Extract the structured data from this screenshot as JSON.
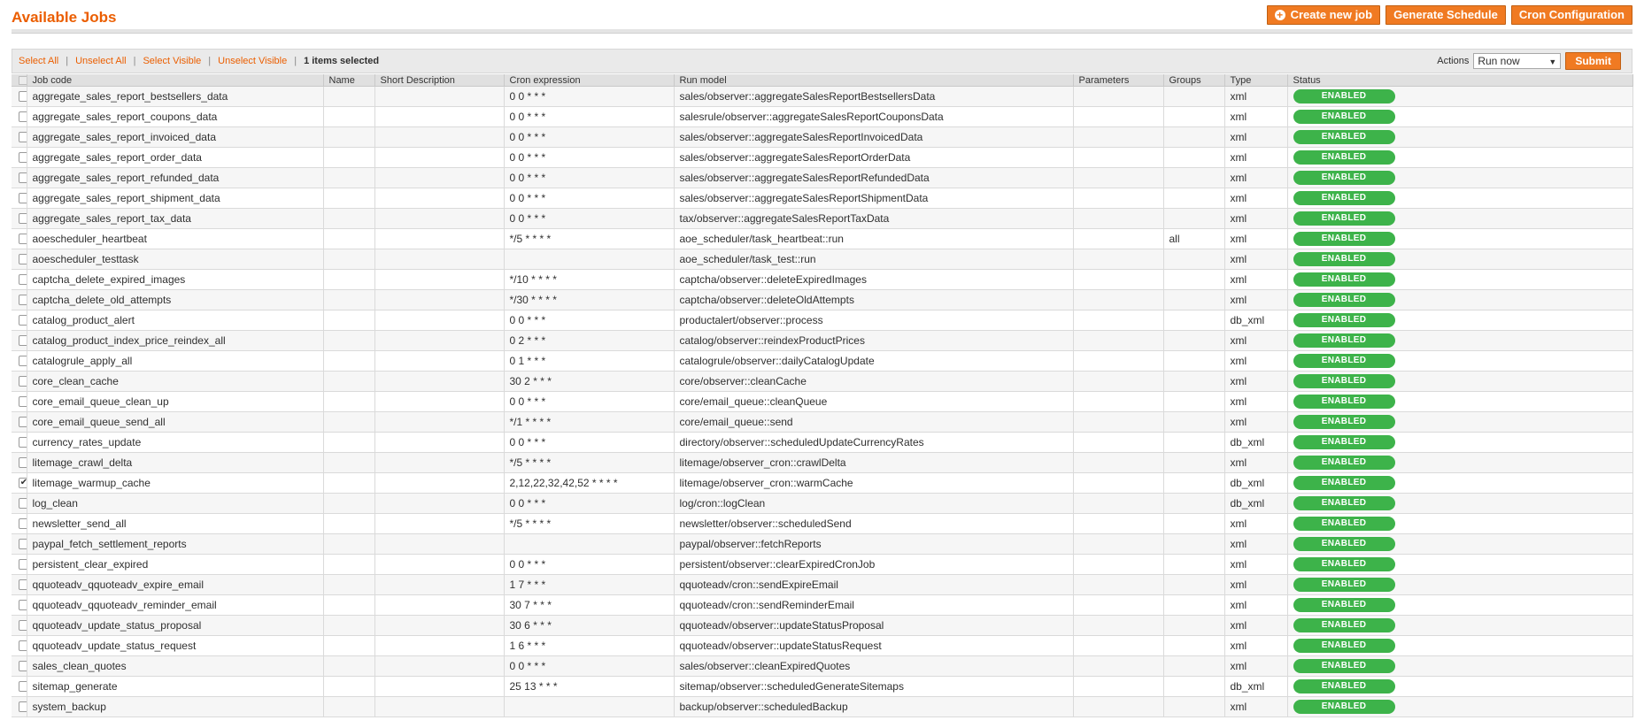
{
  "page": {
    "title": "Available Jobs",
    "buttons": {
      "create": "Create new job",
      "generate": "Generate Schedule",
      "config": "Cron Configuration"
    }
  },
  "massaction": {
    "select_all": "Select All",
    "unselect_all": "Unselect All",
    "select_visible": "Select Visible",
    "unselect_visible": "Unselect Visible",
    "selected_count": "1 items selected",
    "actions_label": "Actions",
    "action_value": "Run now",
    "submit_label": "Submit"
  },
  "grid": {
    "columns": [
      "Job code",
      "Name",
      "Short Description",
      "Cron expression",
      "Run model",
      "Parameters",
      "Groups",
      "Type",
      "Status"
    ],
    "rows": [
      {
        "code": "aggregate_sales_report_bestsellers_data",
        "cron": "0 0 * * *",
        "model": "sales/observer::aggregateSalesReportBestsellersData",
        "groups": "",
        "type": "xml",
        "status": "ENABLED",
        "checked": false
      },
      {
        "code": "aggregate_sales_report_coupons_data",
        "cron": "0 0 * * *",
        "model": "salesrule/observer::aggregateSalesReportCouponsData",
        "groups": "",
        "type": "xml",
        "status": "ENABLED",
        "checked": false
      },
      {
        "code": "aggregate_sales_report_invoiced_data",
        "cron": "0 0 * * *",
        "model": "sales/observer::aggregateSalesReportInvoicedData",
        "groups": "",
        "type": "xml",
        "status": "ENABLED",
        "checked": false
      },
      {
        "code": "aggregate_sales_report_order_data",
        "cron": "0 0 * * *",
        "model": "sales/observer::aggregateSalesReportOrderData",
        "groups": "",
        "type": "xml",
        "status": "ENABLED",
        "checked": false
      },
      {
        "code": "aggregate_sales_report_refunded_data",
        "cron": "0 0 * * *",
        "model": "sales/observer::aggregateSalesReportRefundedData",
        "groups": "",
        "type": "xml",
        "status": "ENABLED",
        "checked": false
      },
      {
        "code": "aggregate_sales_report_shipment_data",
        "cron": "0 0 * * *",
        "model": "sales/observer::aggregateSalesReportShipmentData",
        "groups": "",
        "type": "xml",
        "status": "ENABLED",
        "checked": false
      },
      {
        "code": "aggregate_sales_report_tax_data",
        "cron": "0 0 * * *",
        "model": "tax/observer::aggregateSalesReportTaxData",
        "groups": "",
        "type": "xml",
        "status": "ENABLED",
        "checked": false
      },
      {
        "code": "aoescheduler_heartbeat",
        "cron": "*/5 * * * *",
        "model": "aoe_scheduler/task_heartbeat::run",
        "groups": "all",
        "type": "xml",
        "status": "ENABLED",
        "checked": false
      },
      {
        "code": "aoescheduler_testtask",
        "cron": "",
        "model": "aoe_scheduler/task_test::run",
        "groups": "",
        "type": "xml",
        "status": "ENABLED",
        "checked": false
      },
      {
        "code": "captcha_delete_expired_images",
        "cron": "*/10 * * * *",
        "model": "captcha/observer::deleteExpiredImages",
        "groups": "",
        "type": "xml",
        "status": "ENABLED",
        "checked": false
      },
      {
        "code": "captcha_delete_old_attempts",
        "cron": "*/30 * * * *",
        "model": "captcha/observer::deleteOldAttempts",
        "groups": "",
        "type": "xml",
        "status": "ENABLED",
        "checked": false
      },
      {
        "code": "catalog_product_alert",
        "cron": "0 0 * * *",
        "model": "productalert/observer::process",
        "groups": "",
        "type": "db_xml",
        "status": "ENABLED",
        "checked": false
      },
      {
        "code": "catalog_product_index_price_reindex_all",
        "cron": "0 2 * * *",
        "model": "catalog/observer::reindexProductPrices",
        "groups": "",
        "type": "xml",
        "status": "ENABLED",
        "checked": false
      },
      {
        "code": "catalogrule_apply_all",
        "cron": "0 1 * * *",
        "model": "catalogrule/observer::dailyCatalogUpdate",
        "groups": "",
        "type": "xml",
        "status": "ENABLED",
        "checked": false
      },
      {
        "code": "core_clean_cache",
        "cron": "30 2 * * *",
        "model": "core/observer::cleanCache",
        "groups": "",
        "type": "xml",
        "status": "ENABLED",
        "checked": false
      },
      {
        "code": "core_email_queue_clean_up",
        "cron": "0 0 * * *",
        "model": "core/email_queue::cleanQueue",
        "groups": "",
        "type": "xml",
        "status": "ENABLED",
        "checked": false
      },
      {
        "code": "core_email_queue_send_all",
        "cron": "*/1 * * * *",
        "model": "core/email_queue::send",
        "groups": "",
        "type": "xml",
        "status": "ENABLED",
        "checked": false
      },
      {
        "code": "currency_rates_update",
        "cron": "0 0 * * *",
        "model": "directory/observer::scheduledUpdateCurrencyRates",
        "groups": "",
        "type": "db_xml",
        "status": "ENABLED",
        "checked": false
      },
      {
        "code": "litemage_crawl_delta",
        "cron": "*/5 * * * *",
        "model": "litemage/observer_cron::crawlDelta",
        "groups": "",
        "type": "xml",
        "status": "ENABLED",
        "checked": false
      },
      {
        "code": "litemage_warmup_cache",
        "cron": "2,12,22,32,42,52 * * * *",
        "model": "litemage/observer_cron::warmCache",
        "groups": "",
        "type": "db_xml",
        "status": "ENABLED",
        "checked": true
      },
      {
        "code": "log_clean",
        "cron": "0 0 * * *",
        "model": "log/cron::logClean",
        "groups": "",
        "type": "db_xml",
        "status": "ENABLED",
        "checked": false
      },
      {
        "code": "newsletter_send_all",
        "cron": "*/5 * * * *",
        "model": "newsletter/observer::scheduledSend",
        "groups": "",
        "type": "xml",
        "status": "ENABLED",
        "checked": false
      },
      {
        "code": "paypal_fetch_settlement_reports",
        "cron": "",
        "model": "paypal/observer::fetchReports",
        "groups": "",
        "type": "xml",
        "status": "ENABLED",
        "checked": false
      },
      {
        "code": "persistent_clear_expired",
        "cron": "0 0 * * *",
        "model": "persistent/observer::clearExpiredCronJob",
        "groups": "",
        "type": "xml",
        "status": "ENABLED",
        "checked": false
      },
      {
        "code": "qquoteadv_qquoteadv_expire_email",
        "cron": "1 7 * * *",
        "model": "qquoteadv/cron::sendExpireEmail",
        "groups": "",
        "type": "xml",
        "status": "ENABLED",
        "checked": false
      },
      {
        "code": "qquoteadv_qquoteadv_reminder_email",
        "cron": "30 7 * * *",
        "model": "qquoteadv/cron::sendReminderEmail",
        "groups": "",
        "type": "xml",
        "status": "ENABLED",
        "checked": false
      },
      {
        "code": "qquoteadv_update_status_proposal",
        "cron": "30 6 * * *",
        "model": "qquoteadv/observer::updateStatusProposal",
        "groups": "",
        "type": "xml",
        "status": "ENABLED",
        "checked": false
      },
      {
        "code": "qquoteadv_update_status_request",
        "cron": "1 6 * * *",
        "model": "qquoteadv/observer::updateStatusRequest",
        "groups": "",
        "type": "xml",
        "status": "ENABLED",
        "checked": false
      },
      {
        "code": "sales_clean_quotes",
        "cron": "0 0 * * *",
        "model": "sales/observer::cleanExpiredQuotes",
        "groups": "",
        "type": "xml",
        "status": "ENABLED",
        "checked": false
      },
      {
        "code": "sitemap_generate",
        "cron": "25 13 * * *",
        "model": "sitemap/observer::scheduledGenerateSitemaps",
        "groups": "",
        "type": "db_xml",
        "status": "ENABLED",
        "checked": false
      },
      {
        "code": "system_backup",
        "cron": "",
        "model": "backup/observer::scheduledBackup",
        "groups": "",
        "type": "xml",
        "status": "ENABLED",
        "checked": false
      }
    ]
  }
}
